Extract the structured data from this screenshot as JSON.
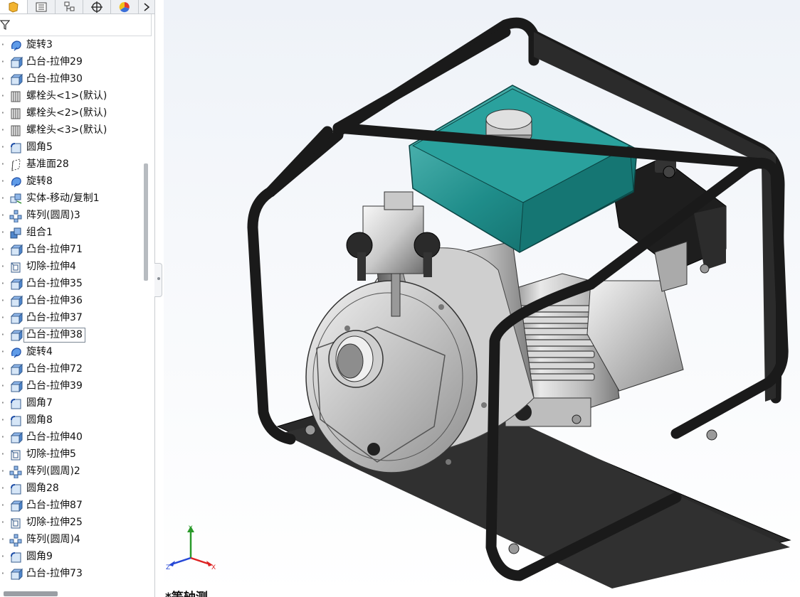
{
  "feature_tree": {
    "items": [
      {
        "label": "旋转3",
        "icon": "revolve-icon"
      },
      {
        "label": "凸台-拉伸29",
        "icon": "boss-extrude-icon"
      },
      {
        "label": "凸台-拉伸30",
        "icon": "boss-extrude-icon"
      },
      {
        "label": "螺栓头<1>(默认)",
        "icon": "bolt-head-icon"
      },
      {
        "label": "螺栓头<2>(默认)",
        "icon": "bolt-head-icon"
      },
      {
        "label": "螺栓头<3>(默认)",
        "icon": "bolt-head-icon"
      },
      {
        "label": "圆角5",
        "icon": "fillet-icon"
      },
      {
        "label": "基准面28",
        "icon": "plane-icon"
      },
      {
        "label": "旋转8",
        "icon": "revolve-icon"
      },
      {
        "label": "实体-移动/复制1",
        "icon": "move-copy-icon"
      },
      {
        "label": "阵列(圆周)3",
        "icon": "circular-pattern-icon"
      },
      {
        "label": "组合1",
        "icon": "combine-icon"
      },
      {
        "label": "凸台-拉伸71",
        "icon": "boss-extrude-icon"
      },
      {
        "label": "切除-拉伸4",
        "icon": "cut-extrude-icon"
      },
      {
        "label": "凸台-拉伸35",
        "icon": "boss-extrude-icon"
      },
      {
        "label": "凸台-拉伸36",
        "icon": "boss-extrude-icon"
      },
      {
        "label": "凸台-拉伸37",
        "icon": "boss-extrude-icon"
      },
      {
        "label": "凸台-拉伸38",
        "icon": "boss-extrude-icon",
        "selected": true
      },
      {
        "label": "旋转4",
        "icon": "revolve-icon"
      },
      {
        "label": "凸台-拉伸72",
        "icon": "boss-extrude-icon"
      },
      {
        "label": "凸台-拉伸39",
        "icon": "boss-extrude-icon"
      },
      {
        "label": "圆角7",
        "icon": "fillet-icon"
      },
      {
        "label": "圆角8",
        "icon": "fillet-icon"
      },
      {
        "label": "凸台-拉伸40",
        "icon": "boss-extrude-icon"
      },
      {
        "label": "切除-拉伸5",
        "icon": "cut-extrude-icon"
      },
      {
        "label": "阵列(圆周)2",
        "icon": "circular-pattern-icon"
      },
      {
        "label": "圆角28",
        "icon": "fillet-icon"
      },
      {
        "label": "凸台-拉伸87",
        "icon": "boss-extrude-icon"
      },
      {
        "label": "切除-拉伸25",
        "icon": "cut-extrude-icon"
      },
      {
        "label": "阵列(圆周)4",
        "icon": "circular-pattern-icon"
      },
      {
        "label": "圆角9",
        "icon": "fillet-icon"
      },
      {
        "label": "凸台-拉伸73",
        "icon": "boss-extrude-icon"
      }
    ]
  },
  "tabs": [
    {
      "icon": "feature-manager-icon"
    },
    {
      "icon": "property-manager-icon"
    },
    {
      "icon": "configuration-manager-icon"
    },
    {
      "icon": "dimxpert-icon"
    },
    {
      "icon": "display-manager-icon"
    },
    {
      "icon": "chevron-right-icon"
    }
  ],
  "filter": {
    "icon": "filter-icon"
  },
  "viewport": {
    "view_name": "*等轴测",
    "triad": {
      "x": "X",
      "y": "Y",
      "z": "Z"
    }
  },
  "colors": {
    "tank": "#1f8d8a",
    "frame": "#1c1c1c",
    "selection_outline": "#7b8794"
  }
}
